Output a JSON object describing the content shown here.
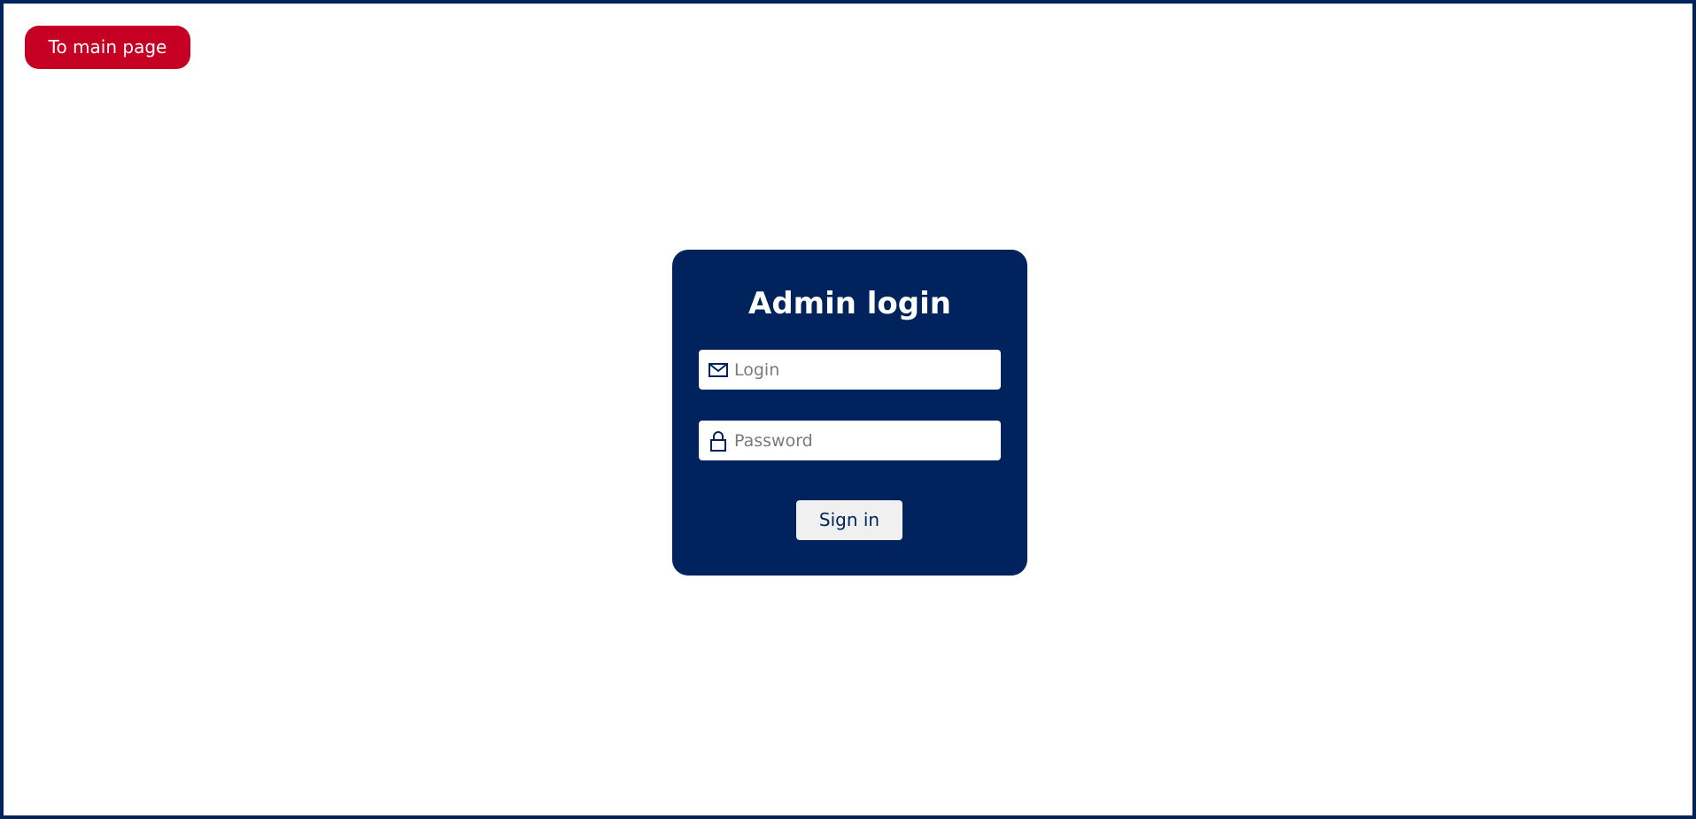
{
  "header": {
    "main_page_button_label": "To main page"
  },
  "login_card": {
    "title": "Admin login",
    "login_field": {
      "icon": "envelope-icon",
      "placeholder": "Login",
      "value": ""
    },
    "password_field": {
      "icon": "lock-icon",
      "placeholder": "Password",
      "value": ""
    },
    "sign_in_label": "Sign in"
  },
  "colors": {
    "frame_border": "#00235d",
    "card_background": "#00235d",
    "main_button_background": "#c50022",
    "sign_in_background": "#f0f0f0",
    "input_background": "#ffffff"
  }
}
